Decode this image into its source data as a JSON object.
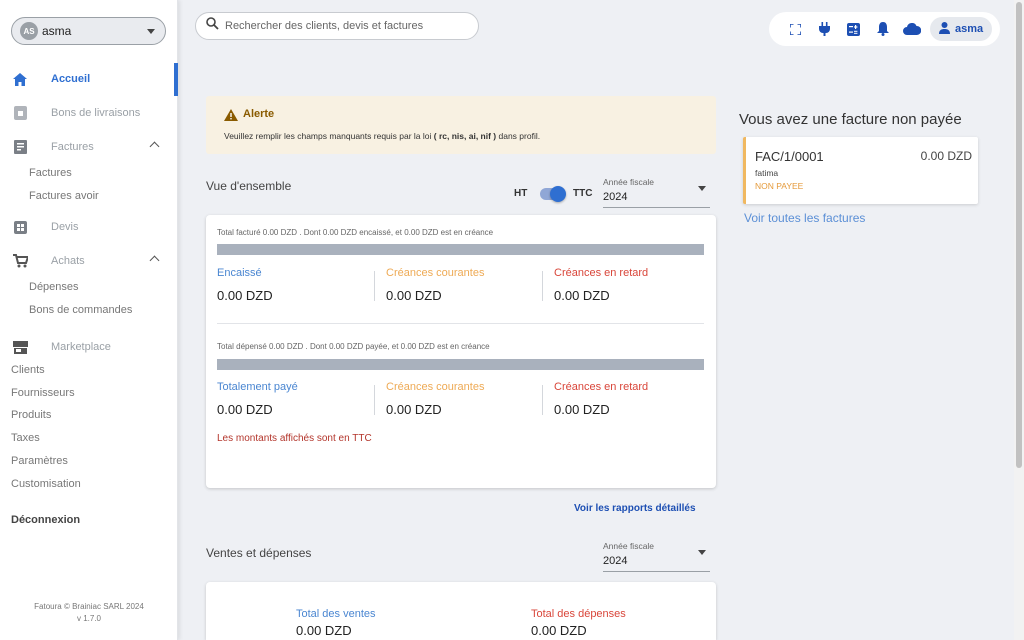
{
  "sidebar": {
    "account": {
      "initials": "AS",
      "name": "asma"
    },
    "items": {
      "home": "Accueil",
      "delivery": "Bons de livraisons",
      "invoices": "Factures",
      "invoices_sub": [
        "Factures",
        "Factures avoir"
      ],
      "quotes": "Devis",
      "purchases": "Achats",
      "purchases_sub": [
        "Dépenses",
        "Bons de commandes"
      ],
      "marketplace": "Marketplace",
      "plain": [
        "Clients",
        "Fournisseurs",
        "Produits",
        "Taxes",
        "Paramètres",
        "Customisation"
      ]
    },
    "logout": "Déconnexion",
    "footer": {
      "copyright": "Fatoura © Brainiac SARL 2024",
      "version": "v 1.7.0"
    }
  },
  "header": {
    "search_placeholder": "Rechercher des clients, devis et factures",
    "icons": [
      "fullscreen-icon",
      "plug-icon",
      "calculator-icon",
      "bell-icon",
      "cloud-icon",
      "user-icon"
    ],
    "user": "asma"
  },
  "alert": {
    "title": "Alerte",
    "text_before": "Veuillez remplir les champs manquants requis par la loi",
    "text_bold": "( rc, nis, ai, nif )",
    "text_after": "dans profil."
  },
  "overview": {
    "title": "Vue d'ensemble",
    "toggle": {
      "left": "HT",
      "right": "TTC",
      "on": true
    },
    "fiscal_year": {
      "label": "Année fiscale",
      "value": "2024"
    },
    "billed": {
      "summary": "Total facturé 0.00 DZD . Dont 0.00 DZD encaissé, et 0.00 DZD est en créance",
      "metrics": [
        {
          "label": "Encaissé",
          "value": "0.00 DZD",
          "color": "#4a86d1"
        },
        {
          "label": "Créances courantes",
          "value": "0.00 DZD",
          "color": "#eeaa55"
        },
        {
          "label": "Créances en retard",
          "value": "0.00 DZD",
          "color": "#d9463a"
        }
      ]
    },
    "spent": {
      "summary": "Total dépensé 0.00 DZD . Dont 0.00 DZD payée, et 0.00 DZD est en créance",
      "metrics": [
        {
          "label": "Totalement payé",
          "value": "0.00 DZD",
          "color": "#4a86d1"
        },
        {
          "label": "Créances courantes",
          "value": "0.00 DZD",
          "color": "#eeaa55"
        },
        {
          "label": "Créances en retard",
          "value": "0.00 DZD",
          "color": "#d9463a"
        }
      ]
    },
    "note": "Les montants affichés sont en TTC",
    "report_link": "Voir les rapports détaillés"
  },
  "sales": {
    "title": "Ventes et dépenses",
    "fiscal_year": {
      "label": "Année fiscale",
      "value": "2024"
    },
    "metrics": [
      {
        "label": "Total des ventes",
        "value": "0.00 DZD",
        "color": "#4a86d1"
      },
      {
        "label": "Total des dépenses",
        "value": "0.00 DZD",
        "color": "#d9463a"
      }
    ]
  },
  "unpaid": {
    "title": "Vous avez une facture non payée",
    "invoice": {
      "number": "FAC/1/0001",
      "amount": "0.00 DZD",
      "client": "fatima",
      "status": "NON PAYEE"
    },
    "link": "Voir toutes les factures"
  },
  "colors": {
    "accent": "#2f6fd1",
    "alert_bg": "#f8f1e2",
    "invoice_border": "#f0b860"
  }
}
